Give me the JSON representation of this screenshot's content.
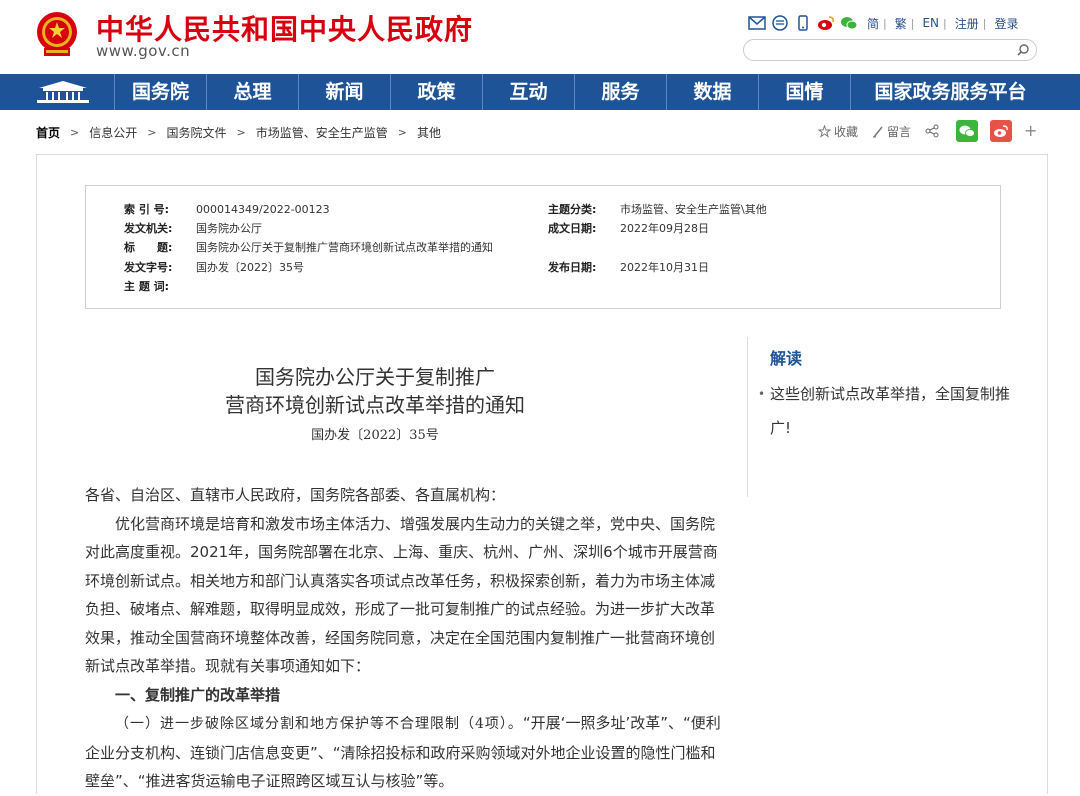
{
  "header": {
    "site_title": "中华人民共和国中央人民政府",
    "site_url": "www.gov.cn",
    "lang_links": [
      "简",
      "繁",
      "EN",
      "注册",
      "登录"
    ],
    "search_placeholder": ""
  },
  "nav": {
    "items": [
      "国务院",
      "总理",
      "新闻",
      "政策",
      "互动",
      "服务",
      "数据",
      "国情",
      "国家政务服务平台"
    ]
  },
  "breadcrumb": [
    "首页",
    "信息公开",
    "国务院文件",
    "市场监管、安全生产监管",
    "其他"
  ],
  "actions": {
    "favorite": "收藏",
    "comment": "留言"
  },
  "meta": {
    "index_label": "索 引 号:",
    "index_value": "000014349/2022-00123",
    "topic_label": "主题分类:",
    "topic_value": "市场监管、安全生产监管\\其他",
    "issuer_label": "发文机关:",
    "issuer_value": "国务院办公厅",
    "date_written_label": "成文日期:",
    "date_written_value": "2022年09月28日",
    "title_label": "标　　题:",
    "title_value": "国务院办公厅关于复制推广营商环境创新试点改革举措的通知",
    "docno_label": "发文字号:",
    "docno_value": "国办发〔2022〕35号",
    "publish_label": "发布日期:",
    "publish_value": "2022年10月31日",
    "keywords_label": "主 题 词:"
  },
  "article": {
    "title_line1": "国务院办公厅关于复制推广",
    "title_line2": "营商环境创新试点改革举措的通知",
    "docno": "国办发〔2022〕35号",
    "salutation": "各省、自治区、直辖市人民政府，国务院各部委、各直属机构：",
    "para1": "优化营商环境是培育和激发市场主体活力、增强发展内生动力的关键之举，党中央、国务院对此高度重视。2021年，国务院部署在北京、上海、重庆、杭州、广州、深圳6个城市开展营商环境创新试点。相关地方和部门认真落实各项试点改革任务，积极探索创新，着力为市场主体减负担、破堵点、解难题，取得明显成效，形成了一批可复制推广的试点经验。为进一步扩大改革效果，推动全国营商环境整体改善，经国务院同意，决定在全国范围内复制推广一批营商环境创新试点改革举措。现就有关事项通知如下：",
    "heading1": "一、复制推广的改革举措",
    "para2_serif": "（一）进一步破除区域分割和地方保护等不合理限制（4项）。",
    "para2_rest": "“开展‘一照多址’改革”、“便利企业分支机构、连锁门店信息变更”、“清除招投标和政府采购领域对外地企业设置的隐性门槛和壁垒”、“推进客货运输电子证照跨区域互认与核验”等。"
  },
  "sidebar": {
    "title": "解读",
    "item": "这些创新试点改革举措，全国复制推广!"
  }
}
